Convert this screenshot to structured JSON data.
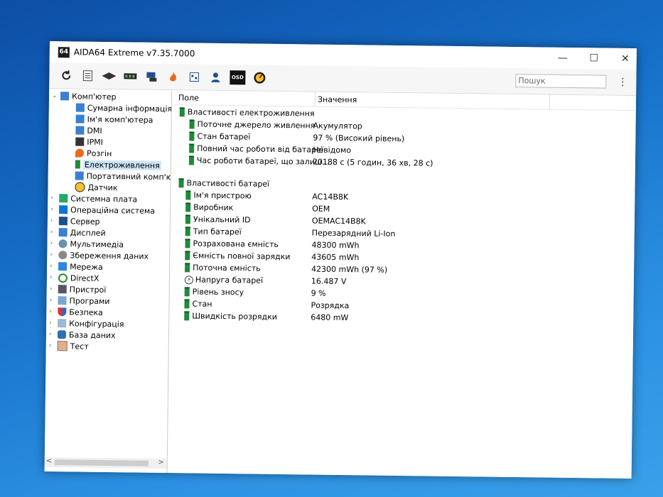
{
  "window": {
    "title": "AIDA64 Extreme v7.35.7000",
    "app_icon_text": "64",
    "controls": {
      "minimize": "—",
      "maximize": "☐",
      "close": "✕"
    }
  },
  "toolbar": {
    "icons": [
      "refresh-icon",
      "report-icon",
      "motherboard-icon",
      "memory-icon",
      "network-icon",
      "benchmark-flame-icon",
      "preferences-icon",
      "user-icon",
      "osd-icon",
      "gauge-icon"
    ],
    "osd_label": "OSD",
    "search_placeholder": "Пошук",
    "menu": "⋮"
  },
  "tree": {
    "root": "Комп'ютер",
    "children": [
      "Сумарна інформація",
      "Ім'я комп'ютера",
      "DMI",
      "IPMI",
      "Розгін",
      "Електроживлення",
      "Портативний комп'юте",
      "Датчик"
    ],
    "selected": "Електроживлення",
    "groups": [
      "Системна плата",
      "Операційна система",
      "Сервер",
      "Дисплей",
      "Мультимедіа",
      "Збереження даних",
      "Мережа",
      "DirectX",
      "Пристрої",
      "Програми",
      "Безпека",
      "Конфігурація",
      "База даних",
      "Тест"
    ],
    "expand_glyph": "›",
    "collapse_glyph": "⌄"
  },
  "columns": {
    "field": "Поле",
    "value": "Значення"
  },
  "sections": [
    {
      "title": "Властивості електроживлення",
      "rows": [
        {
          "field": "Поточне джерело живлення",
          "value": "Акумулятор"
        },
        {
          "field": "Стан батареї",
          "value": "97 % (Високий рівень)"
        },
        {
          "field": "Повний час роботи від батареї",
          "value": "Невідомо"
        },
        {
          "field": "Час роботи батареї, що залиш...",
          "value": "20188 с (5 годин, 36 хв, 28 с)"
        }
      ]
    },
    {
      "title": "Властивості батареї",
      "rows": [
        {
          "field": "Ім'я пристрою",
          "value": "AC14B8K"
        },
        {
          "field": "Виробник",
          "value": "OEM"
        },
        {
          "field": "Унікальний ID",
          "value": "OEMAC14B8K"
        },
        {
          "field": "Тип батареї",
          "value": "Перезарядний Li-Ion"
        },
        {
          "field": "Розрахована ємність",
          "value": "48300 mWh"
        },
        {
          "field": "Ємність повної зарядки",
          "value": "43605 mWh"
        },
        {
          "field": "Поточна ємність",
          "value": "42300 mWh  (97 %)"
        },
        {
          "field": "Напруга батареї",
          "value": "16.487 V",
          "icon": "bolt"
        },
        {
          "field": "Рівень зносу",
          "value": "9 %"
        },
        {
          "field": "Стан",
          "value": "Розрядка"
        },
        {
          "field": "Швидкість розрядки",
          "value": "6480 mW"
        }
      ]
    }
  ],
  "scrollbar": {
    "left_arrow": "<",
    "right_arrow": ">"
  }
}
